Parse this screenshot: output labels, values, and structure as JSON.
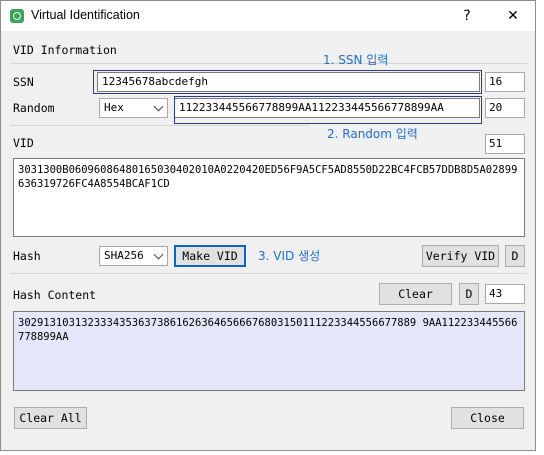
{
  "window": {
    "title": "Virtual Identification",
    "help_label": "?",
    "close_label": "✕"
  },
  "section": {
    "vid_information": "VID Information"
  },
  "annotations": {
    "step1": "1. SSN 입력",
    "step2": "2. Random 입력",
    "step3": "3. VID 생성"
  },
  "ssn": {
    "label": "SSN",
    "value": "12345678abcdefgh",
    "count": "16"
  },
  "random": {
    "label": "Random",
    "format_selected": "Hex",
    "value": "112233445566778899AA112233445566778899AA",
    "count": "20"
  },
  "vid": {
    "label": "VID",
    "count": "51",
    "value": "3031300B06096086480165030402010A0220420ED56F9A5CF5AD8550D22BC4FCB57DDB8D5A02899636319726FC4A8554BCAF1CD"
  },
  "hash": {
    "label": "Hash",
    "algorithm_selected": "SHA256",
    "make_vid_label": "Make VID",
    "verify_vid_label": "Verify VID",
    "d_label": "D"
  },
  "hash_content": {
    "label": "Hash Content",
    "clear_label": "Clear",
    "d_label": "D",
    "count": "43",
    "value": "302913103132333435363738616263646566676803150111223344556677889 9AA112233445566778899AA"
  },
  "footer": {
    "clear_all_label": "Clear All",
    "close_label": "Close"
  },
  "colors": {
    "accent": "#1e6fd0",
    "hash_bg": "#e6e6fa",
    "focus": "#0a64d0",
    "highlight": "#2b3b8c"
  }
}
